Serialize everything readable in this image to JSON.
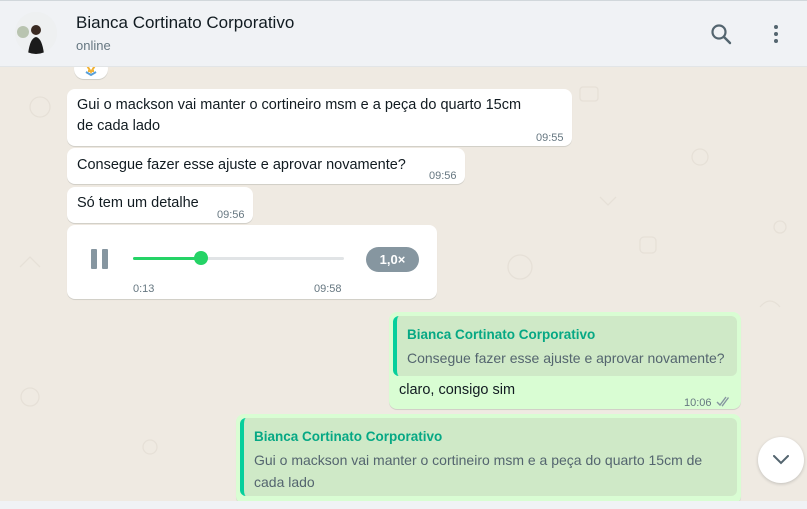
{
  "header": {
    "contact_name": "Bianca Cortinato Corporativo",
    "status": "online",
    "icons": [
      "search-icon",
      "menu-icon"
    ]
  },
  "messages": [
    {
      "text_line1": "Gui o mackson vai manter o cortineiro msm e a peça do quarto 15cm",
      "text_line2": "de cada lado",
      "time": "09:55"
    },
    {
      "text": "Consegue fazer esse ajuste e aprovar novamente?",
      "time": "09:56"
    },
    {
      "text": "Só tem um detalhe",
      "time": "09:56"
    },
    {
      "type": "voice",
      "elapsed": "0:13",
      "time": "09:58",
      "speed": "1,0×",
      "progress": 0.32
    }
  ],
  "outgoing": [
    {
      "quote_name": "Bianca Cortinato Corporativo",
      "quote_text": "Consegue fazer esse ajuste e aprovar novamente?",
      "text": "claro, consigo sim",
      "time": "10:06",
      "status_icon": "double-check-icon"
    },
    {
      "quote_name": "Bianca Cortinato Corporativo",
      "quote_text_line1": "Gui o mackson vai manter o cortineiro msm e a peça do quarto 15cm de",
      "quote_text_line2": "cada lado"
    }
  ],
  "colors": {
    "header_bg": "#f0f2f5",
    "chat_bg": "#efeae2",
    "outgoing_bg": "#d9fdd3",
    "quote_accent": "#06cf9c"
  }
}
